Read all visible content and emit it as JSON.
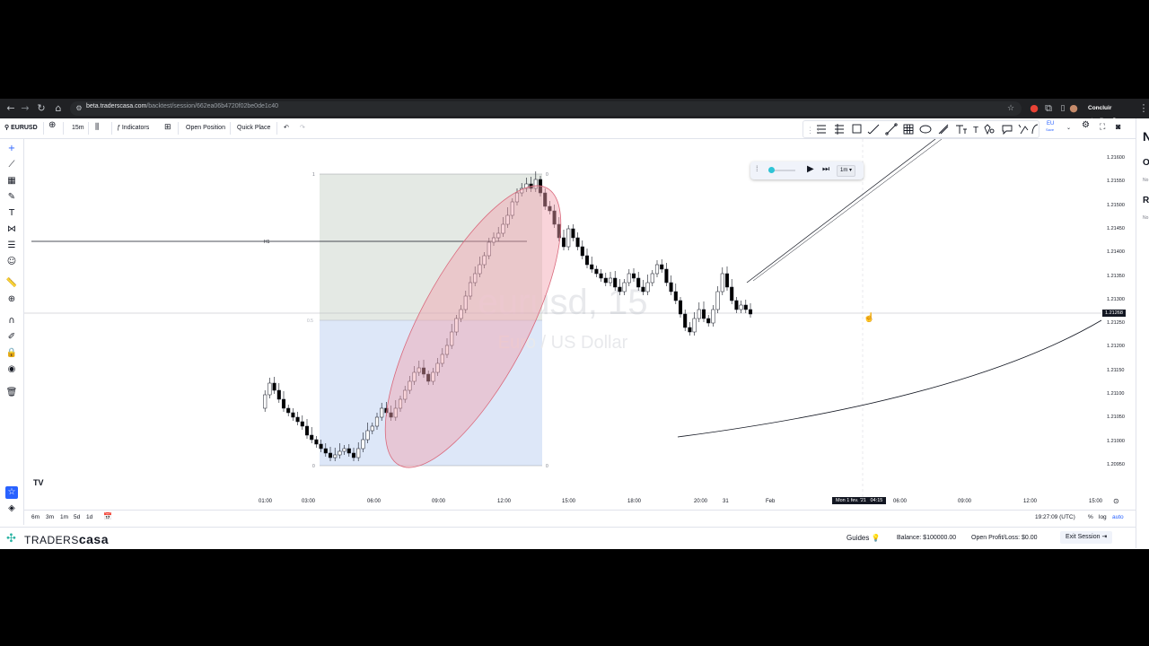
{
  "browser": {
    "url_host": "beta.traderscasa.com",
    "url_path": "/backtest/session/662ea06b4720f02be0de1c40",
    "update_label": "Concluir atualização"
  },
  "toolbar": {
    "symbol": "EURUSD",
    "interval": "15m",
    "indicators_label": "Indicators",
    "open_position_label": "Open Position",
    "quick_place_label": "Quick Place",
    "flag_label": "EU",
    "flag_sub": "Save"
  },
  "replay": {
    "speed": "1m"
  },
  "chart": {
    "watermark_symbol": "eurusd, 15",
    "watermark_name": "Euro / US Dollar",
    "current_price": "1.21268",
    "fib_levels": {
      "top": "1",
      "mid": "0.5",
      "bottom": "0",
      "top_right": "0",
      "bottom_right": "0"
    },
    "h1_label": "H1",
    "price_labels": [
      "1.21600",
      "1.21550",
      "1.21500",
      "1.21450",
      "1.21400",
      "1.21350",
      "1.21300",
      "1.21250",
      "1.21200",
      "1.21150",
      "1.21100",
      "1.21050",
      "1.21000",
      "1.20950"
    ],
    "time_labels": [
      "01:00",
      "03:00",
      "06:00",
      "09:00",
      "12:00",
      "15:00",
      "18:00",
      "20:00",
      "31",
      "Feb",
      "06:00",
      "09:00",
      "12:00",
      "15:00"
    ],
    "crosshair_time": "Mon 1 fev. '21   04:15"
  },
  "bottom": {
    "ranges": [
      "6m",
      "3m",
      "1m",
      "5d",
      "1d"
    ],
    "clock": "19:27:09 (UTC)",
    "pct": "%",
    "log": "log",
    "auto": "auto"
  },
  "footer": {
    "brand_a": "TRADERS",
    "brand_b": "casa",
    "guides": "Guides",
    "balance": "Balance: $100000.00",
    "pnl": "Open Profit/Loss: $0.00",
    "exit": "Exit Session"
  },
  "right_panel": {
    "letters": [
      "N",
      "O",
      "No",
      "R",
      "No"
    ]
  },
  "colors": {
    "up": "#ffffff",
    "down": "#000000",
    "ellipse_fill": "#f2b8c0",
    "fib_top": "#e3e8e3",
    "fib_bottom": "#dce6f7",
    "accent": "#2962ff"
  }
}
